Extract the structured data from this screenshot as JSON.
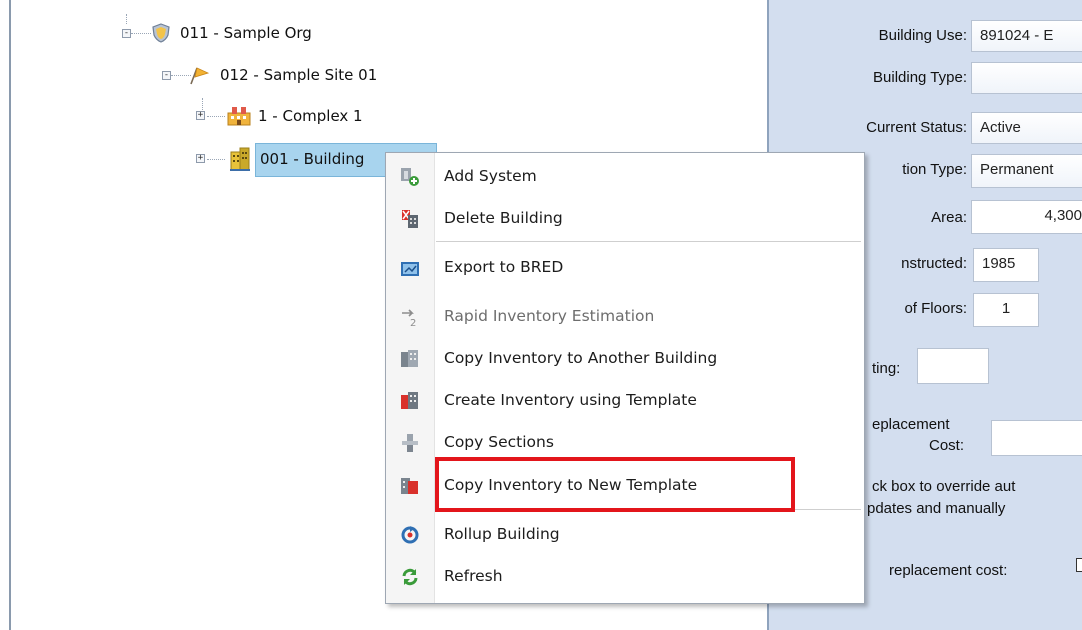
{
  "tree": {
    "nodes": [
      {
        "label": "011 - Sample Org",
        "icon": "shield-icon"
      },
      {
        "label": "012 - Sample Site 01",
        "icon": "flag-icon"
      },
      {
        "label": "1 - Complex 1",
        "icon": "complex-icon"
      },
      {
        "label": "001 - Building",
        "icon": "building-icon"
      }
    ]
  },
  "context_menu": {
    "items": [
      {
        "label": "Add System",
        "icon": "add-system-icon"
      },
      {
        "label": "Delete Building",
        "icon": "delete-building-icon"
      },
      {
        "label": "Export to BRED",
        "icon": "export-icon"
      },
      {
        "label": "Rapid Inventory Estimation",
        "icon": "rapid-estimation-icon",
        "disabled": true
      },
      {
        "label": "Copy Inventory to Another Building",
        "icon": "copy-inventory-icon"
      },
      {
        "label": "Create Inventory using Template",
        "icon": "template-icon"
      },
      {
        "label": "Copy Sections",
        "icon": "copy-sections-icon"
      },
      {
        "label": "Copy Inventory to New Template",
        "icon": "new-template-icon",
        "highlighted": true
      },
      {
        "label": "Rollup Building",
        "icon": "rollup-icon"
      },
      {
        "label": "Refresh",
        "icon": "refresh-icon"
      }
    ]
  },
  "form": {
    "building_use_label": "Building Use:",
    "building_use_value": "891024 - E",
    "building_type_label": "Building Type:",
    "building_type_value": "",
    "current_status_label": "Current Status:",
    "current_status_value": "Active",
    "construction_type_label": "tion Type:",
    "construction_type_value": "Permanent",
    "area_label": "Area:",
    "area_value": "4,300",
    "year_constructed_label": "nstructed:",
    "year_constructed_value": "1985",
    "floors_label": "of Floors:",
    "floors_value": "1",
    "rating_label": "ting:",
    "replacement_label_1": "eplacement",
    "replacement_label_2": "Cost:",
    "override_text_1": "ck box to override aut",
    "override_text_2": "pdates and manually",
    "override_text_3": "replacement cost:"
  },
  "colors": {
    "panel_bg": "#d3deef",
    "selection": "#a8d4ee",
    "highlight_border": "#e3151b"
  }
}
